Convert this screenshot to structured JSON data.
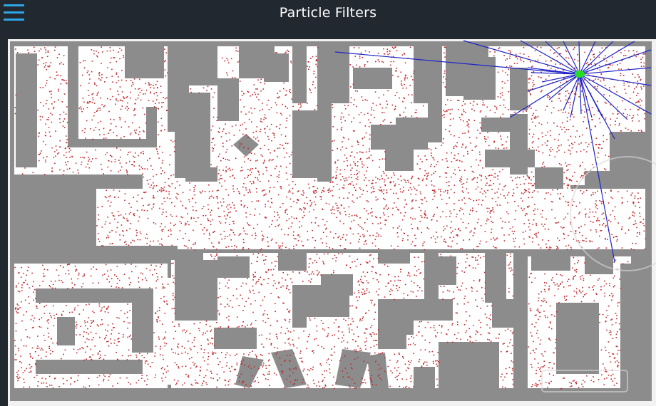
{
  "header": {
    "title": "Particle Filters",
    "menu_icon": "hamburger-menu-icon",
    "background": "#222830",
    "menu_color": "#2fa7e6"
  },
  "map": {
    "floor_color": "#ffffff",
    "wall_color": "#8c8c8c",
    "particle_color": "#c0282d",
    "laser_color": "#1f25c7",
    "robot_color": "#22dd22"
  }
}
